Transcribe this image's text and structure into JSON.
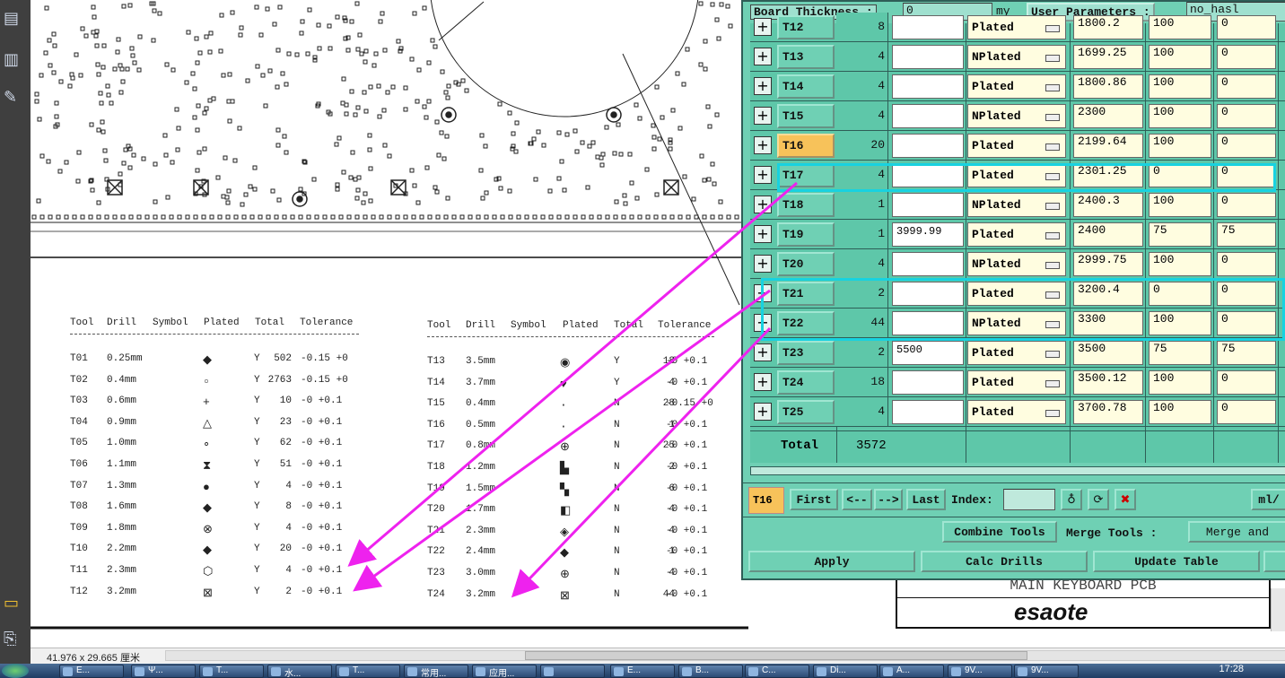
{
  "viewer": {
    "dimension_readout": "41.976 x 29.665 厘米",
    "sidebar_icons": [
      "pages-icon",
      "bookmarks-icon",
      "signatures-icon",
      "comment-icon",
      "attachment-icon"
    ]
  },
  "drawing": {
    "title_block": "MAIN KEYBOARD PCB",
    "logo_text": "esaote",
    "left_table": {
      "headers": [
        "Tool",
        "Drill",
        "Symbol",
        "Plated",
        "Total",
        "Tolerance"
      ],
      "rows": [
        {
          "tool": "T01",
          "drill": "0.25mm",
          "symbol": "◆",
          "plated": "Y",
          "total": "502",
          "tol": "-0.15 +0"
        },
        {
          "tool": "T02",
          "drill": "0.4mm",
          "symbol": "▫",
          "plated": "Y",
          "total": "2763",
          "tol": "-0.15 +0"
        },
        {
          "tool": "T03",
          "drill": "0.6mm",
          "symbol": "+",
          "plated": "Y",
          "total": "10",
          "tol": "-0 +0.1"
        },
        {
          "tool": "T04",
          "drill": "0.9mm",
          "symbol": "△",
          "plated": "Y",
          "total": "23",
          "tol": "-0 +0.1"
        },
        {
          "tool": "T05",
          "drill": "1.0mm",
          "symbol": "∘",
          "plated": "Y",
          "total": "62",
          "tol": "-0 +0.1"
        },
        {
          "tool": "T06",
          "drill": "1.1mm",
          "symbol": "⧗",
          "plated": "Y",
          "total": "51",
          "tol": "-0 +0.1"
        },
        {
          "tool": "T07",
          "drill": "1.3mm",
          "symbol": "●",
          "plated": "Y",
          "total": "4",
          "tol": "-0 +0.1"
        },
        {
          "tool": "T08",
          "drill": "1.6mm",
          "symbol": "◆",
          "plated": "Y",
          "total": "8",
          "tol": "-0 +0.1"
        },
        {
          "tool": "T09",
          "drill": "1.8mm",
          "symbol": "⊗",
          "plated": "Y",
          "total": "4",
          "tol": "-0 +0.1"
        },
        {
          "tool": "T10",
          "drill": "2.2mm",
          "symbol": "◆",
          "plated": "Y",
          "total": "20",
          "tol": "-0 +0.1"
        },
        {
          "tool": "T11",
          "drill": "2.3mm",
          "symbol": "⬡",
          "plated": "Y",
          "total": "4",
          "tol": "-0 +0.1"
        },
        {
          "tool": "T12",
          "drill": "3.2mm",
          "symbol": "⊠",
          "plated": "Y",
          "total": "2",
          "tol": "-0 +0.1"
        }
      ]
    },
    "right_table": {
      "headers": [
        "Tool",
        "Drill",
        "Symbol",
        "Plated",
        "Total",
        "Tolerance"
      ],
      "rows": [
        {
          "tool": "T13",
          "drill": "3.5mm",
          "symbol": "◉",
          "plated": "Y",
          "total": "18",
          "tol": "-0 +0.1"
        },
        {
          "tool": "T14",
          "drill": "3.7mm",
          "symbol": "♥",
          "plated": "Y",
          "total": "4",
          "tol": "-0 +0.1"
        },
        {
          "tool": "T15",
          "drill": "0.4mm",
          "symbol": "·",
          "plated": "N",
          "total": "28",
          "tol": "-0.15 +0"
        },
        {
          "tool": "T16",
          "drill": "0.5mm",
          "symbol": "·",
          "plated": "N",
          "total": "1",
          "tol": "-0 +0.1"
        },
        {
          "tool": "T17",
          "drill": "0.8mm",
          "symbol": "⊕",
          "plated": "N",
          "total": "25",
          "tol": "-0 +0.1"
        },
        {
          "tool": "T18",
          "drill": "1.2mm",
          "symbol": "▙",
          "plated": "N",
          "total": "2",
          "tol": "-0 +0.1"
        },
        {
          "tool": "T19",
          "drill": "1.5mm",
          "symbol": "▚",
          "plated": "N",
          "total": "6",
          "tol": "-0 +0.1"
        },
        {
          "tool": "T20",
          "drill": "1.7mm",
          "symbol": "◧",
          "plated": "N",
          "total": "4",
          "tol": "-0 +0.1"
        },
        {
          "tool": "T21",
          "drill": "2.3mm",
          "symbol": "◈",
          "plated": "N",
          "total": "4",
          "tol": "-0 +0.1"
        },
        {
          "tool": "T22",
          "drill": "2.4mm",
          "symbol": "◆",
          "plated": "N",
          "total": "1",
          "tol": "-0 +0.1"
        },
        {
          "tool": "T23",
          "drill": "3.0mm",
          "symbol": "⊕",
          "plated": "N",
          "total": "4",
          "tol": "-0 +0.1"
        },
        {
          "tool": "T24",
          "drill": "3.2mm",
          "symbol": "⊠",
          "plated": "N",
          "total": "44",
          "tol": "-0 +0.1"
        }
      ]
    }
  },
  "dialog": {
    "board_thickness_label": "Board Thickness :",
    "board_thickness_value": "0",
    "unit": "my",
    "user_params_label": "User Parameters :",
    "user_params_value": "no_hasl",
    "rows": [
      {
        "tool": "T12",
        "count": "8",
        "input": "",
        "plated": "Plated",
        "size": "1800.2",
        "a": "100",
        "b": "0"
      },
      {
        "tool": "T13",
        "count": "4",
        "input": "",
        "plated": "NPlated",
        "size": "1699.25",
        "a": "100",
        "b": "0"
      },
      {
        "tool": "T14",
        "count": "4",
        "input": "",
        "plated": "Plated",
        "size": "1800.86",
        "a": "100",
        "b": "0"
      },
      {
        "tool": "T15",
        "count": "4",
        "input": "",
        "plated": "NPlated",
        "size": "2300",
        "a": "100",
        "b": "0"
      },
      {
        "tool": "T16",
        "count": "20",
        "input": "",
        "plated": "Plated",
        "size": "2199.64",
        "a": "100",
        "b": "0"
      },
      {
        "tool": "T17",
        "count": "4",
        "input": "",
        "plated": "Plated",
        "size": "2301.25",
        "a": "0",
        "b": "0"
      },
      {
        "tool": "T18",
        "count": "1",
        "input": "",
        "plated": "NPlated",
        "size": "2400.3",
        "a": "100",
        "b": "0"
      },
      {
        "tool": "T19",
        "count": "1",
        "input": "3999.99",
        "plated": "Plated",
        "size": "2400",
        "a": "75",
        "b": "75"
      },
      {
        "tool": "T20",
        "count": "4",
        "input": "",
        "plated": "NPlated",
        "size": "2999.75",
        "a": "100",
        "b": "0"
      },
      {
        "tool": "T21",
        "count": "2",
        "input": "",
        "plated": "Plated",
        "size": "3200.4",
        "a": "0",
        "b": "0"
      },
      {
        "tool": "T22",
        "count": "44",
        "input": "",
        "plated": "NPlated",
        "size": "3300",
        "a": "100",
        "b": "0"
      },
      {
        "tool": "T23",
        "count": "2",
        "input": "5500",
        "plated": "Plated",
        "size": "3500",
        "a": "75",
        "b": "75"
      },
      {
        "tool": "T24",
        "count": "18",
        "input": "",
        "plated": "Plated",
        "size": "3500.12",
        "a": "100",
        "b": "0"
      },
      {
        "tool": "T25",
        "count": "4",
        "input": "",
        "plated": "Plated",
        "size": "3700.78",
        "a": "100",
        "b": "0"
      }
    ],
    "selected_tool": "T16",
    "total_label": "Total",
    "total_value": "3572",
    "nav": {
      "current": "T16",
      "first": "First",
      "prev": "<--",
      "next": "-->",
      "last": "Last",
      "index_label": "Index:",
      "index_value": "",
      "units": "ml/"
    },
    "combine_tools": "Combine Tools",
    "merge_tools_label": "Merge Tools :",
    "merge_value": "Merge and",
    "apply": "Apply",
    "calc_drills": "Calc Drills",
    "update_table": "Update Table"
  },
  "taskbar": {
    "items": [
      "E...",
      "Ψ...",
      "T...",
      "水...",
      "T...",
      "常用...",
      "应用...",
      " ",
      "E...",
      "B...",
      "C...",
      "Di...",
      "A...",
      "9V...",
      "9V..."
    ],
    "clock": "17:28"
  },
  "colors": {
    "dialog_bg": "#6fd0b4",
    "selected": "#f7c25a",
    "highlight": "#18d2e0",
    "arrow": "#ee22ee",
    "field_yellow": "#fffde0"
  }
}
